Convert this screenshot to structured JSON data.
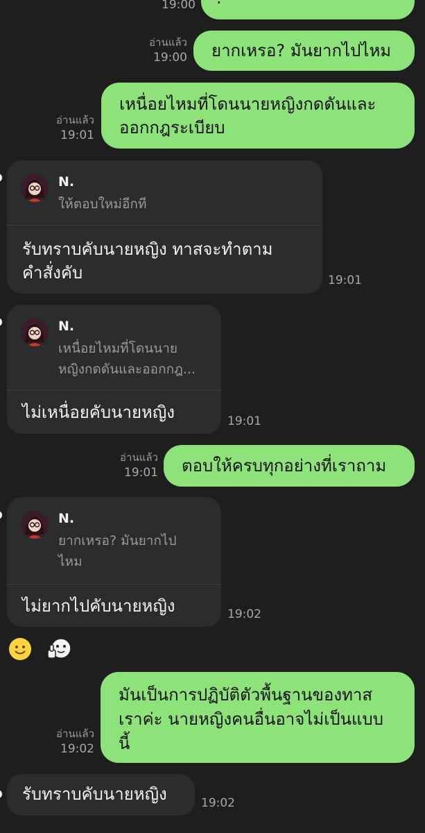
{
  "messages": {
    "out0": {
      "time": "19:00",
      "text": "."
    },
    "out1": {
      "read": "อ่านแล้ว",
      "time": "19:00",
      "text": "ยากเหรอ? มันยากไปไหม"
    },
    "out2": {
      "read": "อ่านแล้ว",
      "time": "19:01",
      "lines": [
        "เหนื่อยไหมที่โดนนายหญิงกดดันและ",
        "ออกกฎระเบียบ"
      ]
    },
    "in1": {
      "reply_name": "N.",
      "reply_quote": [
        "ให้ตอบใหม่อีกที"
      ],
      "lines": [
        "รับทราบคับนายหญิง ทาสจะทำตาม",
        "คำสั่งคับ"
      ],
      "time": "19:01"
    },
    "in2": {
      "reply_name": "N.",
      "reply_quote": [
        "เหนื่อยไหมที่โดนนาย",
        "หญิงกดดันและออกกฎ..."
      ],
      "lines": [
        "ไม่เหนื่อยคับนายหญิง"
      ],
      "time": "19:01"
    },
    "out3": {
      "read": "อ่านแล้ว",
      "time": "19:01",
      "text": "ตอบให้ครบทุกอย่างที่เราถาม"
    },
    "in3": {
      "reply_name": "N.",
      "reply_quote": [
        "ยากเหรอ? มันยากไป",
        "ไหม"
      ],
      "lines": [
        "ไม่ยากไปคับนายหญิง"
      ],
      "time": "19:02"
    },
    "stickers": [
      "smile-emoji",
      "thumbs-up-sticker"
    ],
    "out4": {
      "read": "อ่านแล้ว",
      "time": "19:02",
      "lines": [
        "มันเป็นการปฏิบัติตัวพื้นฐานของทาส",
        "เราค่ะ นายหญิงคนอื่นอาจไม่เป็นแบบ",
        "นี้"
      ]
    },
    "in4": {
      "lines": [
        "รับทราบคับนายหญิง"
      ],
      "time": "19:02"
    }
  },
  "colors": {
    "background": "#1e1e1e",
    "outgoing": "#8de27a",
    "incoming": "#2c2c2e"
  }
}
